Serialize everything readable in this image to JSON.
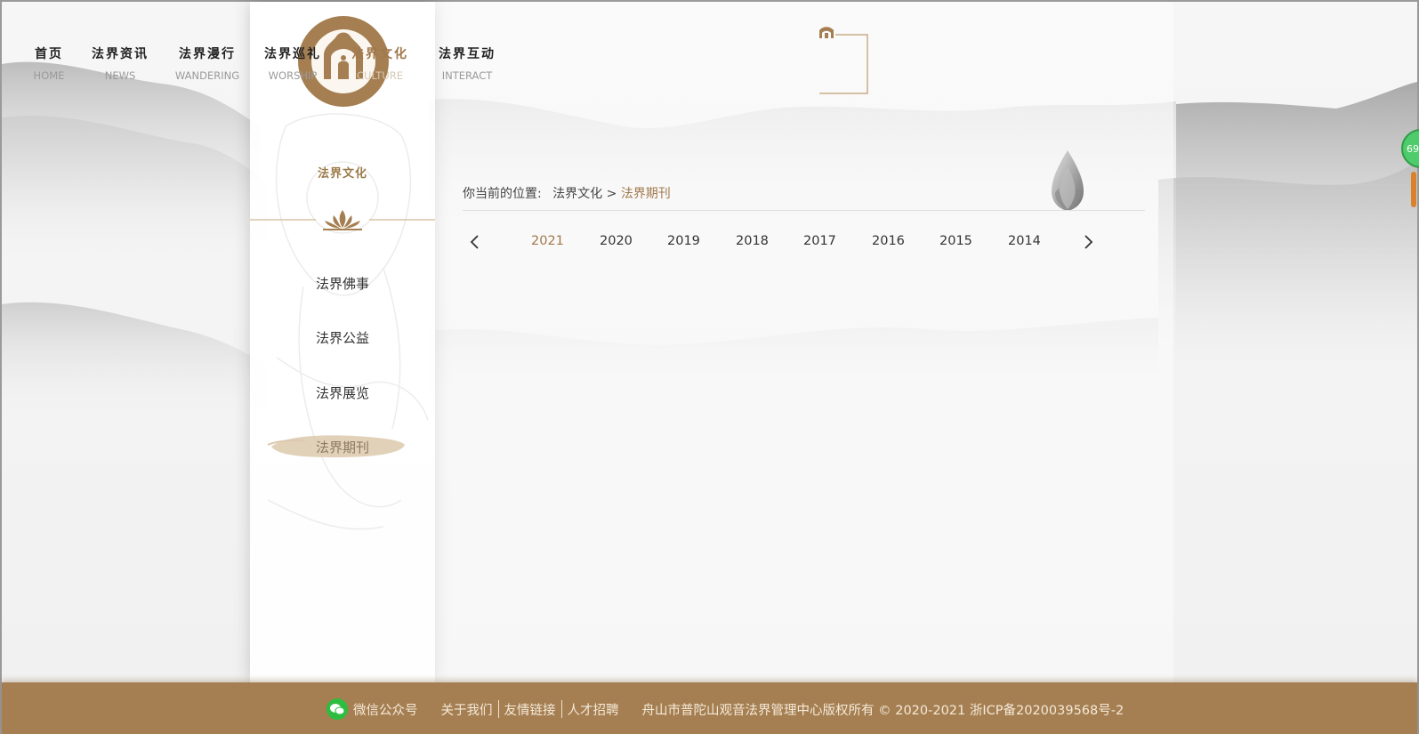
{
  "colors": {
    "accent": "#a1784b",
    "footer": "#a57f52",
    "active_pill": "#dcc9ad"
  },
  "sidebar": {
    "title": "法界文化",
    "items": [
      {
        "label": "法界佛事",
        "active": false
      },
      {
        "label": "法界公益",
        "active": false
      },
      {
        "label": "法界展览",
        "active": false
      },
      {
        "label": "法界期刊",
        "active": true
      }
    ]
  },
  "nav": {
    "items": [
      {
        "cn": "首页",
        "en": "HOME",
        "active": false
      },
      {
        "cn": "法界资讯",
        "en": "NEWS",
        "active": false
      },
      {
        "cn": "法界漫行",
        "en": "WANDERING",
        "active": false
      },
      {
        "cn": "法界巡礼",
        "en": "WORSHIP",
        "active": false
      },
      {
        "cn": "法界文化",
        "en": "CULTURE",
        "active": true
      },
      {
        "cn": "法界互动",
        "en": "INTERACT",
        "active": false
      }
    ]
  },
  "breadcrumb": {
    "prefix": "你当前的位置:",
    "section": "法界文化",
    "sep": ">",
    "current": "法界期刊"
  },
  "years": {
    "selected": "2021",
    "list": [
      "2021",
      "2020",
      "2019",
      "2018",
      "2017",
      "2016",
      "2015",
      "2014"
    ],
    "prev_icon": "chevron-left-icon",
    "next_icon": "chevron-right-icon"
  },
  "float_ball": {
    "text": "69"
  },
  "footer": {
    "wechat": "微信公众号",
    "links": [
      "关于我们",
      "友情链接",
      "人才招聘"
    ],
    "copyright": "舟山市普陀山观音法界管理中心版权所有 © 2020-2021 浙ICP备2020039568号-2"
  }
}
